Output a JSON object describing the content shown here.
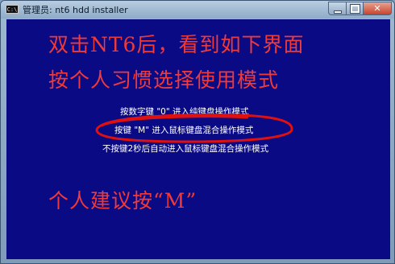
{
  "window": {
    "icon_text": "C:\\",
    "title": "管理员: nt6 hdd installer",
    "min_label": "",
    "max_label": "",
    "close_label": "✕"
  },
  "console": {
    "headline_1": "双击NT6后，看到如下界面",
    "headline_2": "按个人习惯选择使用模式",
    "option_1": "按数字键 \"0\" 进入纯键盘操作模式",
    "option_2": "按键 \"M\" 进入鼠标键盘混合操作模式",
    "option_3": "不按键2秒后自动进入鼠标键盘混合操作模式",
    "recommendation": "个人建议按“M”"
  },
  "colors": {
    "console_bg": "#0a0a84",
    "annotation_red": "#f03a3a",
    "highlight_ellipse": "#e01010"
  }
}
